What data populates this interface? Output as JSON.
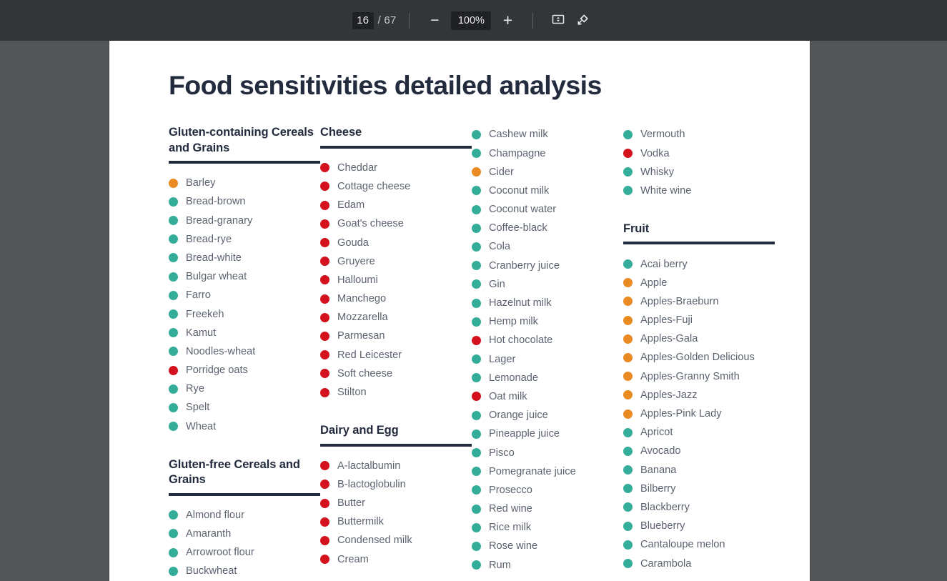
{
  "toolbar": {
    "current_page": "16",
    "page_separator": "/ 67",
    "total_pages": "67",
    "zoom_out_label": "−",
    "zoom_level": "100%",
    "zoom_in_label": "+",
    "fit_icon": "fit-to-page-icon",
    "rotate_icon": "rotate-counterclockwise-icon"
  },
  "document": {
    "title": "Food sensitivities detailed analysis",
    "legend_colors": {
      "green": "#34ae9a",
      "orange": "#e98a22",
      "red": "#d4121e",
      "heading": "#232b3e",
      "body_text": "#5c6370"
    },
    "columns": [
      {
        "sections": [
          {
            "heading": "Gluten-containing Cereals and Grains",
            "items": [
              {
                "label": "Barley",
                "color": "orange"
              },
              {
                "label": "Bread-brown",
                "color": "green"
              },
              {
                "label": "Bread-granary",
                "color": "green"
              },
              {
                "label": "Bread-rye",
                "color": "green"
              },
              {
                "label": "Bread-white",
                "color": "green"
              },
              {
                "label": "Bulgar wheat",
                "color": "green"
              },
              {
                "label": "Farro",
                "color": "green"
              },
              {
                "label": "Freekeh",
                "color": "green"
              },
              {
                "label": "Kamut",
                "color": "green"
              },
              {
                "label": "Noodles-wheat",
                "color": "green"
              },
              {
                "label": "Porridge oats",
                "color": "red"
              },
              {
                "label": "Rye",
                "color": "green"
              },
              {
                "label": "Spelt",
                "color": "green"
              },
              {
                "label": "Wheat",
                "color": "green"
              }
            ]
          },
          {
            "heading": "Gluten-free Cereals and Grains",
            "items": [
              {
                "label": "Almond flour",
                "color": "green"
              },
              {
                "label": "Amaranth",
                "color": "green"
              },
              {
                "label": "Arrowroot flour",
                "color": "green"
              },
              {
                "label": "Buckwheat",
                "color": "green"
              }
            ]
          }
        ]
      },
      {
        "sections": [
          {
            "heading": "Cheese",
            "items": [
              {
                "label": "Cheddar",
                "color": "red"
              },
              {
                "label": "Cottage cheese",
                "color": "red"
              },
              {
                "label": "Edam",
                "color": "red"
              },
              {
                "label": "Goat's cheese",
                "color": "red"
              },
              {
                "label": "Gouda",
                "color": "red"
              },
              {
                "label": "Gruyere",
                "color": "red"
              },
              {
                "label": "Halloumi",
                "color": "red"
              },
              {
                "label": "Manchego",
                "color": "red"
              },
              {
                "label": "Mozzarella",
                "color": "red"
              },
              {
                "label": "Parmesan",
                "color": "red"
              },
              {
                "label": "Red Leicester",
                "color": "red"
              },
              {
                "label": "Soft cheese",
                "color": "red"
              },
              {
                "label": "Stilton",
                "color": "red"
              }
            ]
          },
          {
            "heading": "Dairy and Egg",
            "items": [
              {
                "label": "A-lactalbumin",
                "color": "red"
              },
              {
                "label": "B-lactoglobulin",
                "color": "red"
              },
              {
                "label": "Butter",
                "color": "red"
              },
              {
                "label": "Buttermilk",
                "color": "red"
              },
              {
                "label": "Condensed milk",
                "color": "red"
              },
              {
                "label": "Cream",
                "color": "red"
              }
            ]
          }
        ]
      },
      {
        "sections": [
          {
            "heading": "",
            "items": [
              {
                "label": "Cashew milk",
                "color": "green"
              },
              {
                "label": "Champagne",
                "color": "green"
              },
              {
                "label": "Cider",
                "color": "orange"
              },
              {
                "label": "Coconut milk",
                "color": "green"
              },
              {
                "label": "Coconut water",
                "color": "green"
              },
              {
                "label": "Coffee-black",
                "color": "green"
              },
              {
                "label": "Cola",
                "color": "green"
              },
              {
                "label": "Cranberry juice",
                "color": "green"
              },
              {
                "label": "Gin",
                "color": "green"
              },
              {
                "label": "Hazelnut milk",
                "color": "green"
              },
              {
                "label": "Hemp milk",
                "color": "green"
              },
              {
                "label": "Hot chocolate",
                "color": "red"
              },
              {
                "label": "Lager",
                "color": "green"
              },
              {
                "label": "Lemonade",
                "color": "green"
              },
              {
                "label": "Oat milk",
                "color": "red"
              },
              {
                "label": "Orange juice",
                "color": "green"
              },
              {
                "label": "Pineapple juice",
                "color": "green"
              },
              {
                "label": "Pisco",
                "color": "green"
              },
              {
                "label": "Pomegranate juice",
                "color": "green"
              },
              {
                "label": "Prosecco",
                "color": "green"
              },
              {
                "label": "Red wine",
                "color": "green"
              },
              {
                "label": "Rice milk",
                "color": "green"
              },
              {
                "label": "Rose wine",
                "color": "green"
              },
              {
                "label": "Rum",
                "color": "green"
              }
            ]
          }
        ]
      },
      {
        "sections": [
          {
            "heading": "",
            "items": [
              {
                "label": "Vermouth",
                "color": "green"
              },
              {
                "label": "Vodka",
                "color": "red"
              },
              {
                "label": "Whisky",
                "color": "green"
              },
              {
                "label": "White wine",
                "color": "green"
              }
            ]
          },
          {
            "heading": "Fruit",
            "items": [
              {
                "label": "Acai berry",
                "color": "green"
              },
              {
                "label": "Apple",
                "color": "orange"
              },
              {
                "label": "Apples-Braeburn",
                "color": "orange"
              },
              {
                "label": "Apples-Fuji",
                "color": "orange"
              },
              {
                "label": "Apples-Gala",
                "color": "orange"
              },
              {
                "label": "Apples-Golden Delicious",
                "color": "orange"
              },
              {
                "label": "Apples-Granny Smith",
                "color": "orange"
              },
              {
                "label": "Apples-Jazz",
                "color": "orange"
              },
              {
                "label": "Apples-Pink Lady",
                "color": "orange"
              },
              {
                "label": "Apricot",
                "color": "green"
              },
              {
                "label": "Avocado",
                "color": "green"
              },
              {
                "label": "Banana",
                "color": "green"
              },
              {
                "label": "Bilberry",
                "color": "green"
              },
              {
                "label": "Blackberry",
                "color": "green"
              },
              {
                "label": "Blueberry",
                "color": "green"
              },
              {
                "label": "Cantaloupe melon",
                "color": "green"
              },
              {
                "label": "Carambola",
                "color": "green"
              }
            ]
          }
        ]
      }
    ]
  }
}
